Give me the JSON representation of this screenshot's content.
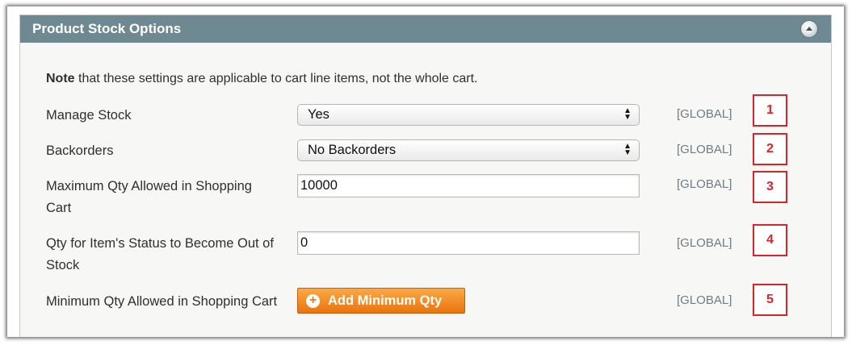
{
  "panel": {
    "title": "Product Stock Options",
    "collapse_icon": "chevron-up-icon"
  },
  "note": {
    "bold": "Note",
    "text": " that these settings are applicable to cart line items, not the whole cart."
  },
  "rows": [
    {
      "label": "Manage Stock",
      "control": "select",
      "value": "Yes",
      "scope": "[GLOBAL]",
      "callout": "1"
    },
    {
      "label": "Backorders",
      "control": "select",
      "value": "No Backorders",
      "scope": "[GLOBAL]",
      "callout": "2"
    },
    {
      "label": "Maximum Qty Allowed in Shopping Cart",
      "control": "text",
      "value": "10000",
      "scope": "[GLOBAL]",
      "callout": "3"
    },
    {
      "label": "Qty for Item's Status to Become Out of Stock",
      "control": "text",
      "value": "0",
      "scope": "[GLOBAL]",
      "callout": "4"
    },
    {
      "label": "Minimum Qty Allowed in Shopping Cart",
      "control": "button",
      "value": "Add Minimum Qty",
      "icon": "plus-circle-icon",
      "scope": "[GLOBAL]",
      "callout": "5"
    }
  ],
  "colors": {
    "header": "#6f8992",
    "button": "#f28c22",
    "callout": "#d6262b",
    "scope": "#6b7d86"
  }
}
